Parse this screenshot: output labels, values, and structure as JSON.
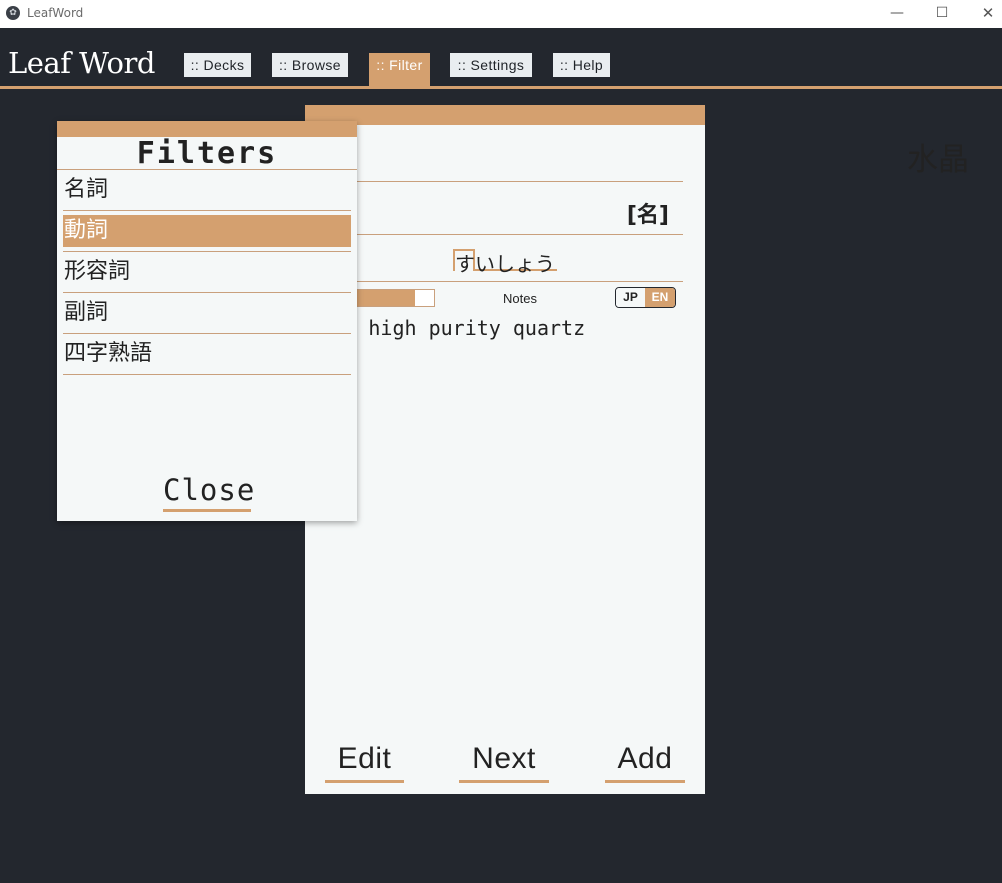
{
  "window": {
    "title": "LeafWord",
    "icon": "app-logo-icon",
    "controls": {
      "minimize": "—",
      "maximize": "☐",
      "close": "✕"
    }
  },
  "header": {
    "brand": "Leaf Word",
    "nav": [
      {
        "label": ":: Decks",
        "active": false
      },
      {
        "label": ":: Browse",
        "active": false
      },
      {
        "label": ":: Filter",
        "active": true
      },
      {
        "label": ":: Settings",
        "active": false
      },
      {
        "label": ":: Help",
        "active": false
      }
    ]
  },
  "card": {
    "word": "水晶",
    "part_of_speech": "[名]",
    "reading": "すいしょう",
    "progress_fraction": 0.85,
    "notes_label": "Notes",
    "language_toggle": {
      "jp": "JP",
      "en": "EN",
      "selected": "EN"
    },
    "definition": "crystal, high purity quartz",
    "actions": {
      "edit": "Edit",
      "next": "Next",
      "add": "Add"
    }
  },
  "filters": {
    "title": "Filters",
    "items": [
      {
        "label": "名詞",
        "selected": false
      },
      {
        "label": "動詞",
        "selected": true
      },
      {
        "label": "形容詞",
        "selected": false
      },
      {
        "label": "副詞",
        "selected": false
      },
      {
        "label": "四字熟語",
        "selected": false
      }
    ],
    "close_label": "Close"
  },
  "colors": {
    "accent": "#d4a06f",
    "background": "#23272e",
    "panel": "#f5f8f8"
  }
}
